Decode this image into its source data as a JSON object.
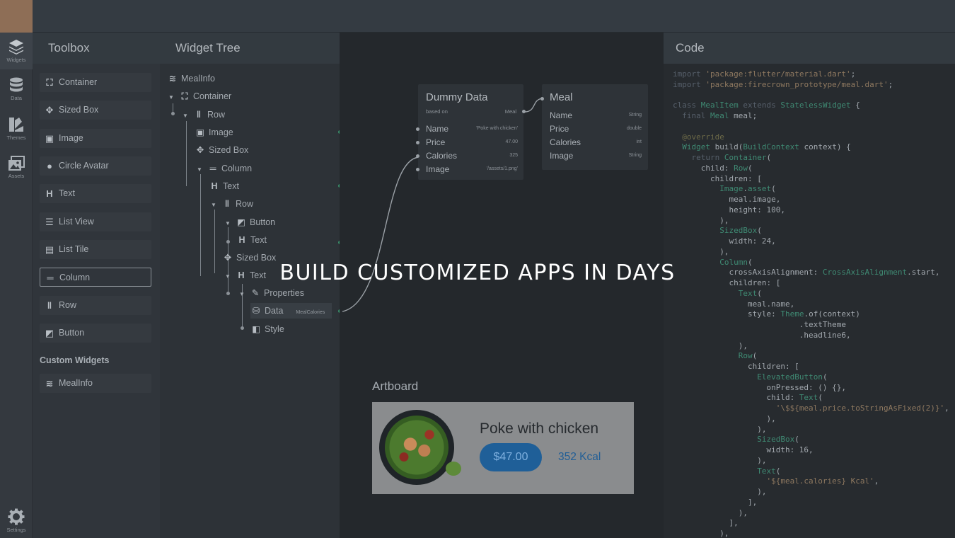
{
  "rail": [
    {
      "label": "Widgets",
      "icon": "layers-icon"
    },
    {
      "label": "Data",
      "icon": "database-icon"
    },
    {
      "label": "Themes",
      "icon": "palette-icon"
    },
    {
      "label": "Assets",
      "icon": "images-icon"
    },
    {
      "label": "Settings",
      "icon": "gear-icon"
    }
  ],
  "toolbox": {
    "title": "Toolbox",
    "items": [
      {
        "label": "Container",
        "icon": "container-icon"
      },
      {
        "label": "Sized Box",
        "icon": "sized-box-icon"
      },
      {
        "label": "Image",
        "icon": "image-icon"
      },
      {
        "label": "Circle Avatar",
        "icon": "avatar-icon"
      },
      {
        "label": "Text",
        "icon": "text-icon"
      },
      {
        "label": "List View",
        "icon": "list-view-icon"
      },
      {
        "label": "List Tile",
        "icon": "list-tile-icon"
      },
      {
        "label": "Column",
        "icon": "column-icon"
      },
      {
        "label": "Row",
        "icon": "row-icon"
      },
      {
        "label": "Button",
        "icon": "button-icon"
      }
    ],
    "custom_section": "Custom Widgets",
    "custom_items": [
      {
        "label": "MealInfo",
        "icon": "layers-icon"
      }
    ]
  },
  "tree": {
    "title": "Widget Tree",
    "nodes": [
      {
        "label": "MealInfo",
        "icon": "layers-icon"
      },
      {
        "label": "Container",
        "icon": "container-icon"
      },
      {
        "label": "Row",
        "icon": "row-icon"
      },
      {
        "label": "Image",
        "icon": "image-icon"
      },
      {
        "label": "Sized Box",
        "icon": "sized-box-icon"
      },
      {
        "label": "Column",
        "icon": "column-icon"
      },
      {
        "label": "Text",
        "icon": "text-icon"
      },
      {
        "label": "Row",
        "icon": "row-icon"
      },
      {
        "label": "Button",
        "icon": "button-icon"
      },
      {
        "label": "Text",
        "icon": "text-icon"
      },
      {
        "label": "Sized Box",
        "icon": "sized-box-icon"
      },
      {
        "label": "Text",
        "icon": "text-icon"
      },
      {
        "label": "Properties",
        "icon": "wrench-icon"
      },
      {
        "label": "Data",
        "icon": "database-icon",
        "tag": "MealCalories"
      },
      {
        "label": "Style",
        "icon": "palette-icon"
      }
    ]
  },
  "dummy": {
    "title": "Dummy Data",
    "based_on_label": "based on",
    "based_on_value": "Meal",
    "fields": [
      {
        "name": "Name",
        "value": "'Poke with chicken'"
      },
      {
        "name": "Price",
        "value": "47.00"
      },
      {
        "name": "Calories",
        "value": "325"
      },
      {
        "name": "Image",
        "value": "'/assets/1.png'"
      }
    ]
  },
  "meal": {
    "title": "Meal",
    "fields": [
      {
        "name": "Name",
        "type": "String"
      },
      {
        "name": "Price",
        "type": "double"
      },
      {
        "name": "Calories",
        "type": "int"
      },
      {
        "name": "Image",
        "type": "String"
      }
    ]
  },
  "artboard": {
    "title": "Artboard",
    "meal_name": "Poke with chicken",
    "price": "$47.00",
    "kcal": "352 Kcal"
  },
  "code": {
    "title": "Code"
  },
  "headline": "BUILD CUSTOMIZED APPS IN DAYS"
}
